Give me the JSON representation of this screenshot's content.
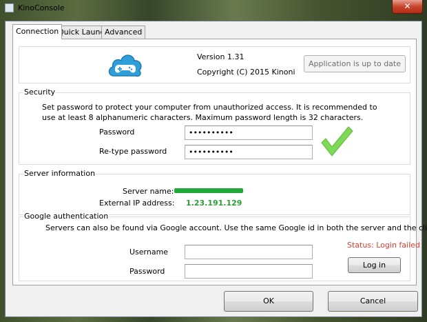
{
  "window": {
    "title": "KinoConsole",
    "close_glyph": "✕"
  },
  "tabs": [
    {
      "label": "Connection",
      "active": true
    },
    {
      "label": "Quick Launch",
      "active": false
    },
    {
      "label": "Advanced",
      "active": false
    }
  ],
  "about": {
    "logo_icon": "cloud-gamepad-icon",
    "version": "Version 1.31",
    "copyright": "Copyright (C) 2015 Kinoni",
    "update_status_button": "Application is up to date"
  },
  "security": {
    "legend": "Security",
    "description": "Set password to protect your computer from unauthorized access. It is recommended to use at least 8 alphanumeric characters. Maximum password length is 32 characters.",
    "password_label": "Password",
    "password_value": "••••••••••",
    "retype_label": "Re-type password",
    "retype_value": "••••••••••",
    "match_icon": "checkmark-icon",
    "match_color": "#7ed957"
  },
  "server": {
    "legend": "Server information",
    "name_label": "Server name:",
    "name_redacted": true,
    "ip_label": "External IP address:",
    "ip_value": "1.23.191.129",
    "value_color": "#2e9a3a"
  },
  "google": {
    "legend": "Google authentication",
    "description": "Servers can also be found via Google account. Use the same Google id in both the server and the client.",
    "username_label": "Username",
    "username_value": "",
    "password_label": "Password",
    "password_value": "",
    "status": "Status: Login failed",
    "status_color": "#e53a2a",
    "login_button": "Log in"
  },
  "footer": {
    "ok": "OK",
    "cancel": "Cancel"
  }
}
